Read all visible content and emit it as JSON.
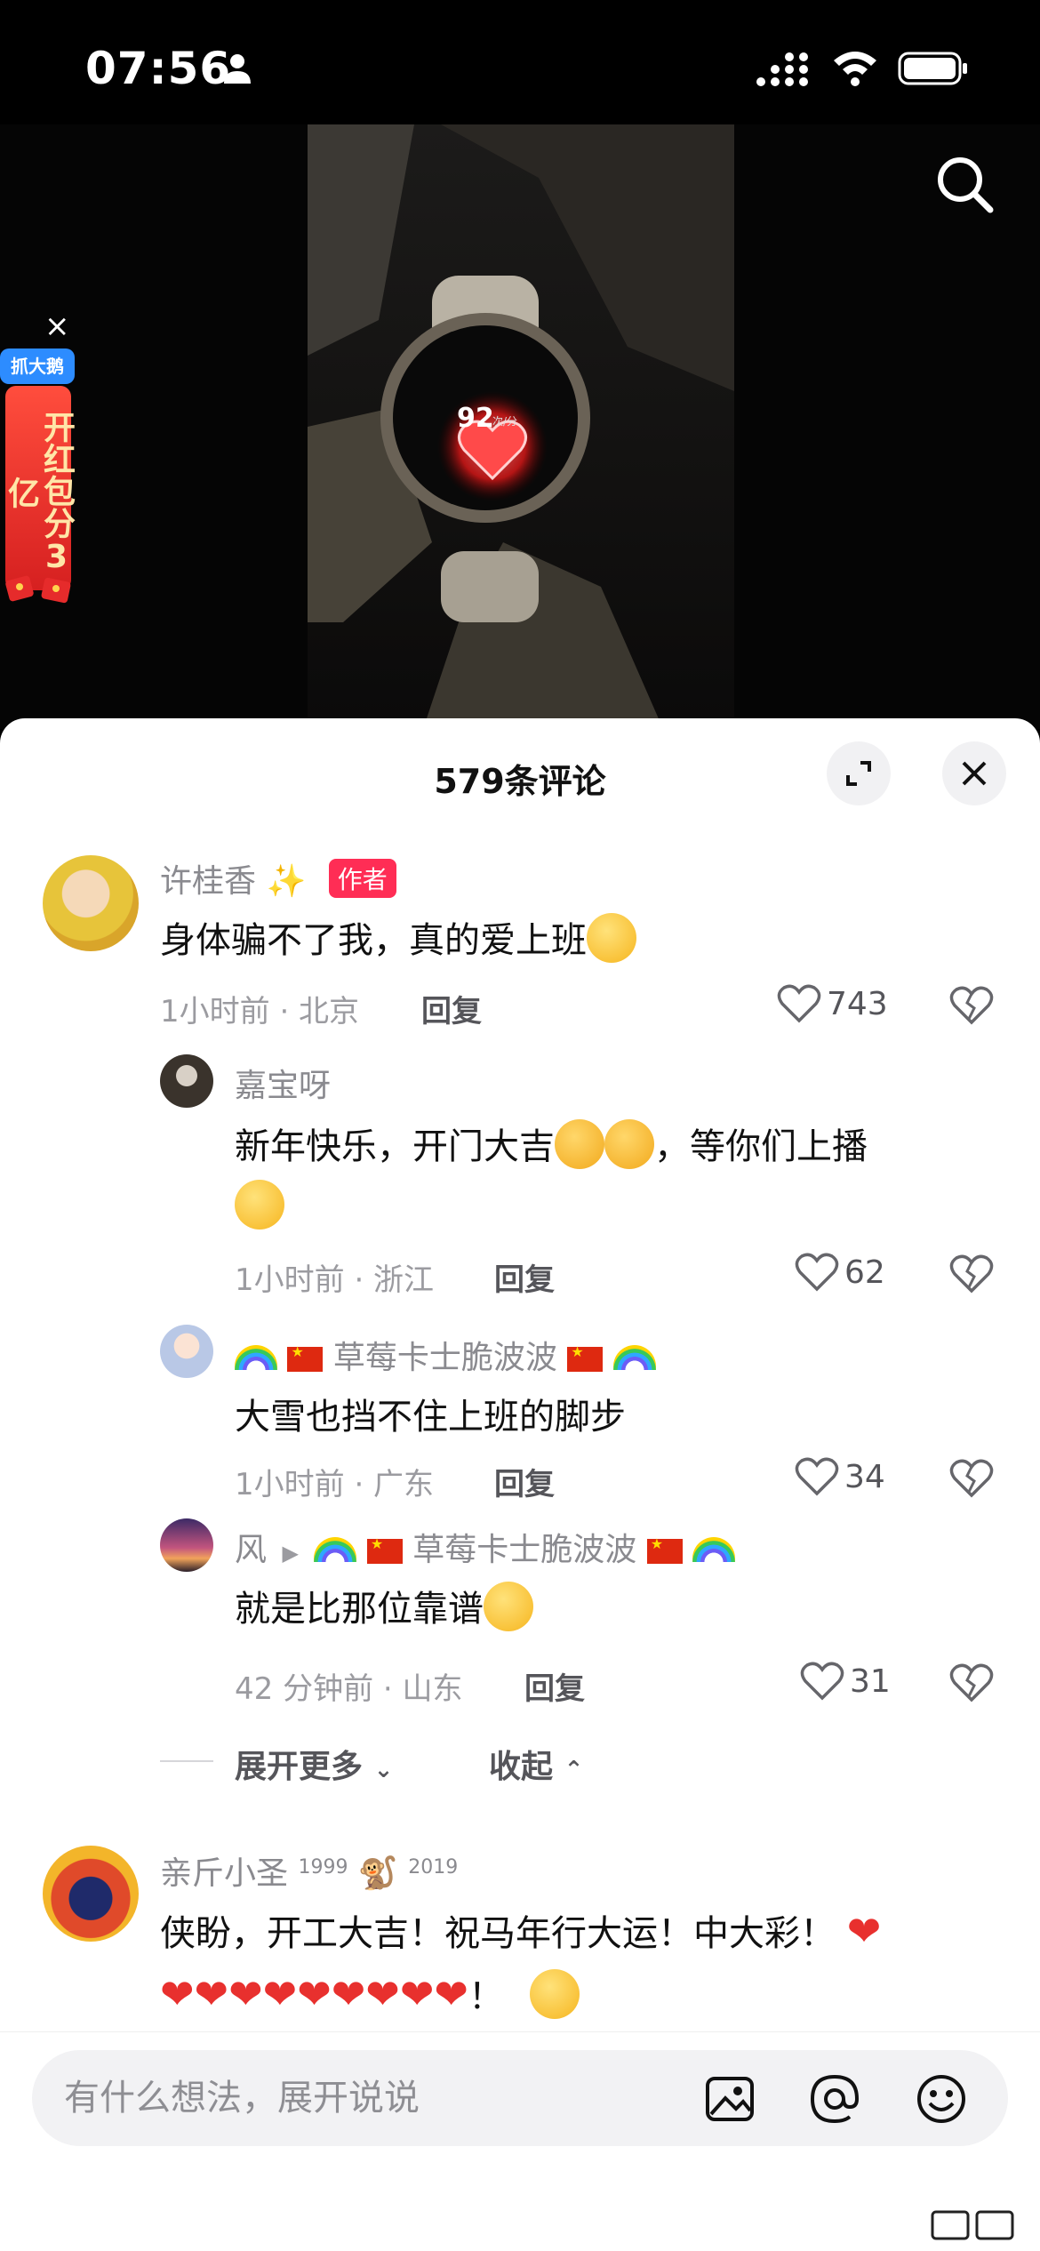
{
  "status_bar": {
    "time": "07:56"
  },
  "ad": {
    "close": "×",
    "tag": "抓大鹅",
    "text": "开红包分3亿"
  },
  "video": {
    "heart_rate": "92",
    "heart_rate_unit": "次/分"
  },
  "sheet": {
    "title": "579条评论"
  },
  "comments": [
    {
      "user": "许桂香",
      "badge": "作者",
      "text": "身体骗不了我，真的爱上班",
      "meta": "1小时前 · 北京",
      "reply": "回复",
      "likes": "743"
    },
    {
      "user": "嘉宝呀",
      "text_a": "新年快乐，开门大吉",
      "text_b": "，等你们上播",
      "meta": "1小时前 · 浙江",
      "reply": "回复",
      "likes": "62"
    },
    {
      "user": "草莓卡士脆波波",
      "text": "大雪也挡不住上班的脚步",
      "meta": "1小时前 · 广东",
      "reply": "回复",
      "likes": "34"
    },
    {
      "user": "风",
      "reply_to": "草莓卡士脆波波",
      "text": "就是比那位靠谱",
      "meta": "42 分钟前 · 山东",
      "reply": "回复",
      "likes": "31"
    },
    {
      "user": "亲斤小圣",
      "year_a": "1999",
      "year_b": "2019",
      "text": "侠盼，开工大吉！祝马年行大运！中大彩！",
      "excl": "！"
    }
  ],
  "thread": {
    "expand_more": "展开更多",
    "collapse": "收起"
  },
  "input": {
    "placeholder": "有什么想法，展开说说"
  }
}
